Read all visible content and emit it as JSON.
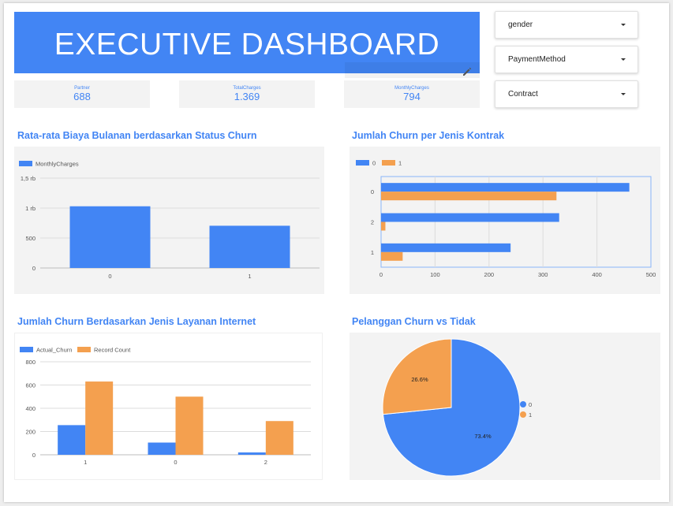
{
  "header": {
    "title": "EXECUTIVE DASHBOARD"
  },
  "kpis": [
    {
      "label": "Partner",
      "value": "688"
    },
    {
      "label": "TotalCharges",
      "value": "1.369"
    },
    {
      "label": "MonthlyCharges",
      "value": "794"
    }
  ],
  "filters": [
    {
      "label": "gender"
    },
    {
      "label": "PaymentMethod"
    },
    {
      "label": "Contract"
    }
  ],
  "colors": {
    "blue": "#4285f4",
    "orange": "#f4a04f",
    "grid": "#dcdcdc"
  },
  "icons": {
    "edit": "pencil-icon",
    "dropdown": "caret-down-icon"
  },
  "chart_data": [
    {
      "type": "bar",
      "title": "Rata-rata Biaya Bulanan berdasarkan Status Churn",
      "categories": [
        "0",
        "1"
      ],
      "series": [
        {
          "name": "MonthlyCharges",
          "values": [
            1030,
            705
          ]
        }
      ],
      "ylim": [
        0,
        1500
      ],
      "yticks": [
        "0",
        "500",
        "1 rb",
        "1,5 rb"
      ],
      "ytick_values": [
        0,
        500,
        1000,
        1500
      ],
      "grid": true,
      "legend": "top-left"
    },
    {
      "type": "bar",
      "orientation": "horizontal",
      "title": "Jumlah Churn per Jenis Kontrak",
      "categories": [
        "0",
        "2",
        "1"
      ],
      "series": [
        {
          "name": "0",
          "values": [
            460,
            330,
            240
          ]
        },
        {
          "name": "1",
          "values": [
            325,
            8,
            40
          ]
        }
      ],
      "xlim": [
        0,
        500
      ],
      "xticks": [
        "0",
        "100",
        "200",
        "300",
        "400",
        "500"
      ],
      "xtick_values": [
        0,
        100,
        200,
        300,
        400,
        500
      ],
      "grid": true,
      "legend": "top-left"
    },
    {
      "type": "bar",
      "title": "Jumlah Churn Berdasarkan Jenis Layanan Internet",
      "categories": [
        "1",
        "0",
        "2"
      ],
      "series": [
        {
          "name": "Actual_Churn",
          "values": [
            255,
            105,
            20
          ]
        },
        {
          "name": "Record Count",
          "values": [
            630,
            500,
            290
          ]
        }
      ],
      "ylim": [
        0,
        800
      ],
      "yticks": [
        "0",
        "200",
        "400",
        "600",
        "800"
      ],
      "ytick_values": [
        0,
        200,
        400,
        600,
        800
      ],
      "grid": true,
      "legend": "top-left"
    },
    {
      "type": "pie",
      "title": "Pelanggan Churn vs Tidak",
      "slices": [
        {
          "name": "0",
          "value": 73.4,
          "label": "73.4%"
        },
        {
          "name": "1",
          "value": 26.6,
          "label": "26.6%"
        }
      ],
      "legend": "right"
    }
  ]
}
